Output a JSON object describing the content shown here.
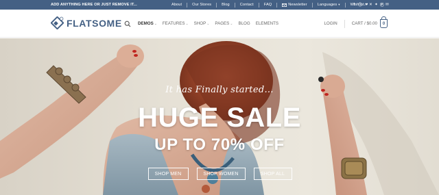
{
  "topbar": {
    "promo": "ADD ANYTHING HERE OR JUST REMOVE IT...",
    "links": [
      "About",
      "Our Stores",
      "Blog",
      "Contact",
      "FAQ"
    ],
    "newsletter": "Newsletter",
    "languages": "Languages",
    "wishlist": "Wishlist",
    "bg_color": "#446084"
  },
  "header": {
    "logo_text": "FLATSOME",
    "nav": [
      {
        "label": "DEMOS",
        "dropdown": true,
        "active": true
      },
      {
        "label": "FEATURES",
        "dropdown": true,
        "active": false
      },
      {
        "label": "SHOP",
        "dropdown": true,
        "active": false
      },
      {
        "label": "PAGES",
        "dropdown": true,
        "active": false
      },
      {
        "label": "BLOG",
        "dropdown": false,
        "active": false
      },
      {
        "label": "ELEMENTS",
        "dropdown": false,
        "active": false
      }
    ],
    "login": "LOGIN",
    "cart": "CART / $0.00",
    "cart_count": "0",
    "accent_color": "#446084"
  },
  "hero": {
    "tagline": "It has Finally started...",
    "headline": "HUGE SALE",
    "subhead": "UP TO 70% OFF",
    "buttons": [
      "SHOP MEN",
      "SHOP WOMEN",
      "SHOP ALL"
    ]
  }
}
